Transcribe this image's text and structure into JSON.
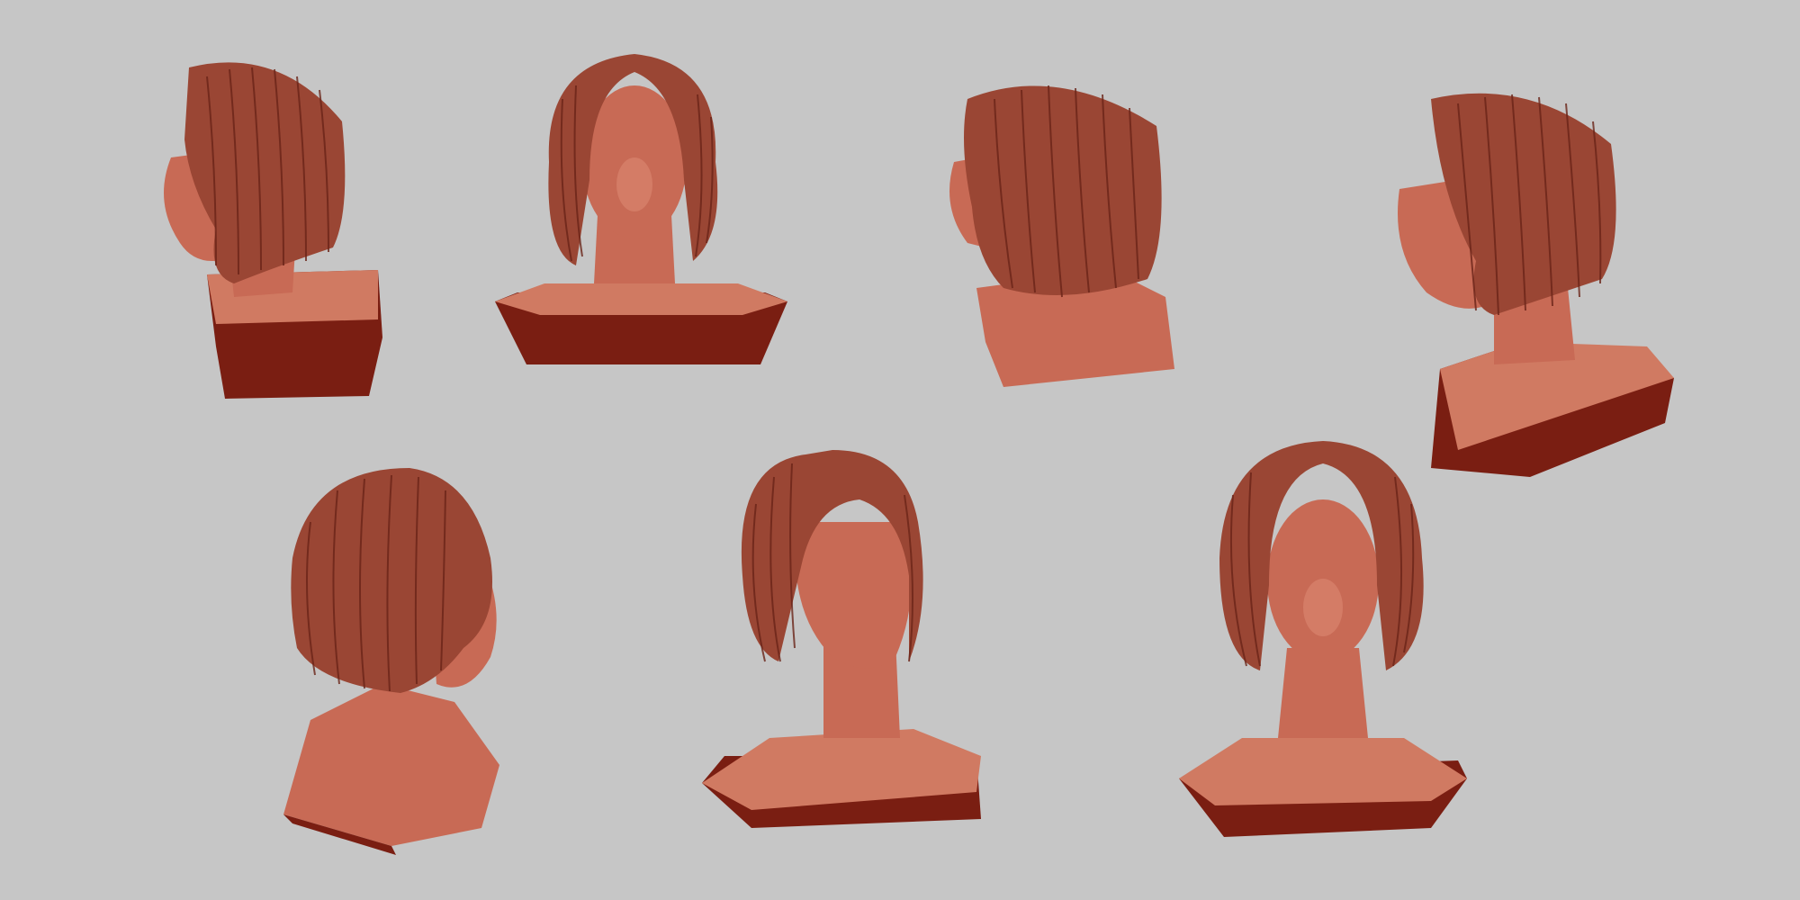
{
  "scene": {
    "background_color": "#c6c6c6",
    "material_colors": {
      "skin": "#c86a55",
      "skin_highlight": "#e08e78",
      "hair": "#9a4634",
      "hair_strand": "#6a2418",
      "base_dark": "#7a1e12",
      "base_top": "#d07a62"
    },
    "views": [
      {
        "id": "left-profile-bust",
        "orientation": "left-profile"
      },
      {
        "id": "front-bust",
        "orientation": "front"
      },
      {
        "id": "left-three-quarter-back-bust",
        "orientation": "left-back-three-quarter"
      },
      {
        "id": "left-three-quarter-bust",
        "orientation": "left-three-quarter"
      },
      {
        "id": "right-profile-bust",
        "orientation": "right-profile"
      },
      {
        "id": "right-three-quarter-bust",
        "orientation": "right-three-quarter"
      },
      {
        "id": "front-low-angle-bust",
        "orientation": "front-low"
      }
    ]
  }
}
